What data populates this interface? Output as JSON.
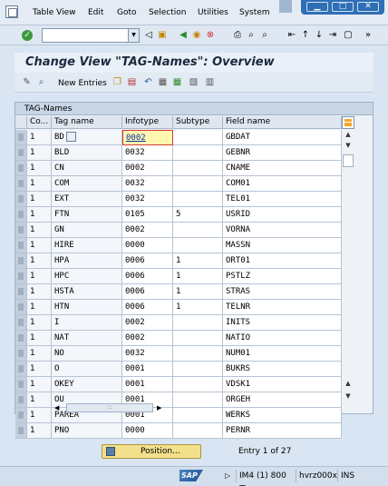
{
  "menu": {
    "items": [
      {
        "label": "Table View"
      },
      {
        "label": "Edit"
      },
      {
        "label": "Goto"
      },
      {
        "label": "Selection"
      },
      {
        "label": "Utilities"
      },
      {
        "label": "System"
      }
    ]
  },
  "window_buttons": {
    "minimize": "▁",
    "restore": "□",
    "close": "✕"
  },
  "toolbar": {
    "command_field_value": "",
    "expand_glyph": "»"
  },
  "title": "Change View \"TAG-Names\": Overview",
  "app_toolbar": {
    "new_entries_label": "New Entries"
  },
  "table": {
    "title": "TAG-Names",
    "headers": {
      "co": "Co...",
      "tag": "Tag name",
      "infotype": "Infotype",
      "subtype": "Subtype",
      "field": "Field name"
    },
    "rows": [
      {
        "co": "1",
        "tag": "BD",
        "infotype": "0002",
        "subtype": "",
        "field": "GBDAT"
      },
      {
        "co": "1",
        "tag": "BLD",
        "infotype": "0032",
        "subtype": "",
        "field": "GEBNR"
      },
      {
        "co": "1",
        "tag": "CN",
        "infotype": "0002",
        "subtype": "",
        "field": "CNAME"
      },
      {
        "co": "1",
        "tag": "COM",
        "infotype": "0032",
        "subtype": "",
        "field": "COM01"
      },
      {
        "co": "1",
        "tag": "EXT",
        "infotype": "0032",
        "subtype": "",
        "field": "TEL01"
      },
      {
        "co": "1",
        "tag": "FTN",
        "infotype": "0105",
        "subtype": "5",
        "field": "USRID"
      },
      {
        "co": "1",
        "tag": "GN",
        "infotype": "0002",
        "subtype": "",
        "field": "VORNA"
      },
      {
        "co": "1",
        "tag": "HIRE",
        "infotype": "0000",
        "subtype": "",
        "field": "MASSN"
      },
      {
        "co": "1",
        "tag": "HPA",
        "infotype": "0006",
        "subtype": "1",
        "field": "ORT01"
      },
      {
        "co": "1",
        "tag": "HPC",
        "infotype": "0006",
        "subtype": "1",
        "field": "PSTLZ"
      },
      {
        "co": "1",
        "tag": "HSTA",
        "infotype": "0006",
        "subtype": "1",
        "field": "STRAS"
      },
      {
        "co": "1",
        "tag": "HTN",
        "infotype": "0006",
        "subtype": "1",
        "field": "TELNR"
      },
      {
        "co": "1",
        "tag": "I",
        "infotype": "0002",
        "subtype": "",
        "field": "INITS"
      },
      {
        "co": "1",
        "tag": "NAT",
        "infotype": "0002",
        "subtype": "",
        "field": "NATIO"
      },
      {
        "co": "1",
        "tag": "NO",
        "infotype": "0032",
        "subtype": "",
        "field": "NUM01"
      },
      {
        "co": "1",
        "tag": "O",
        "infotype": "0001",
        "subtype": "",
        "field": "BUKRS"
      },
      {
        "co": "1",
        "tag": "OKEY",
        "infotype": "0001",
        "subtype": "",
        "field": "VDSK1"
      },
      {
        "co": "1",
        "tag": "OU",
        "infotype": "0001",
        "subtype": "",
        "field": "ORGEH"
      },
      {
        "co": "1",
        "tag": "PAREA",
        "infotype": "0001",
        "subtype": "",
        "field": "WERKS"
      },
      {
        "co": "1",
        "tag": "PNO",
        "infotype": "0000",
        "subtype": "",
        "field": "PERNR"
      }
    ]
  },
  "footer": {
    "position_label": "Position...",
    "entry_text": "Entry 1 of 27"
  },
  "status": {
    "system": "IM4 (1) 800",
    "server": "hvrz000x",
    "mode": "INS"
  },
  "colors": {
    "title": "#1c2a3f",
    "position_button": "#f2e08a",
    "focus_border": "#d63b3b"
  }
}
